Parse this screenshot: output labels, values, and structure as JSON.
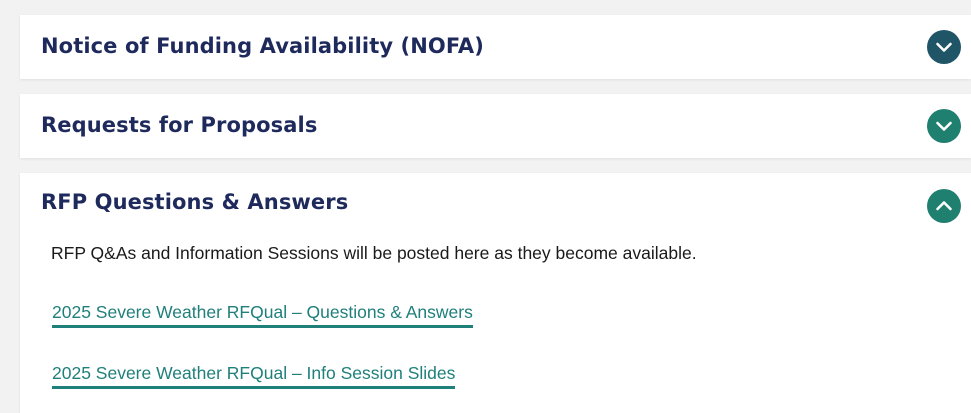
{
  "accordion": {
    "sections": [
      {
        "title": "Notice of Funding Availability (NOFA)",
        "state": "collapsed",
        "toggle_icon": "chevron-down-icon",
        "toggle_color": "#1f5566"
      },
      {
        "title": "Requests for Proposals",
        "state": "collapsed",
        "toggle_icon": "chevron-down-icon",
        "toggle_color": "#1f8070"
      },
      {
        "title": "RFP Questions & Answers",
        "state": "expanded",
        "toggle_icon": "chevron-up-icon",
        "toggle_color": "#1f8070",
        "intro": "RFP Q&As and Information Sessions will be posted here as they become available.",
        "links": [
          {
            "label": "2025 Severe Weather RFQual – Questions & Answers"
          },
          {
            "label": "2025 Severe Weather RFQual – Info Session Slides"
          }
        ]
      }
    ]
  },
  "colors": {
    "page_background": "#f2f2f3",
    "heading": "#1f2a5c",
    "link": "#1f7f7a",
    "body_text": "#1a1a1a"
  }
}
